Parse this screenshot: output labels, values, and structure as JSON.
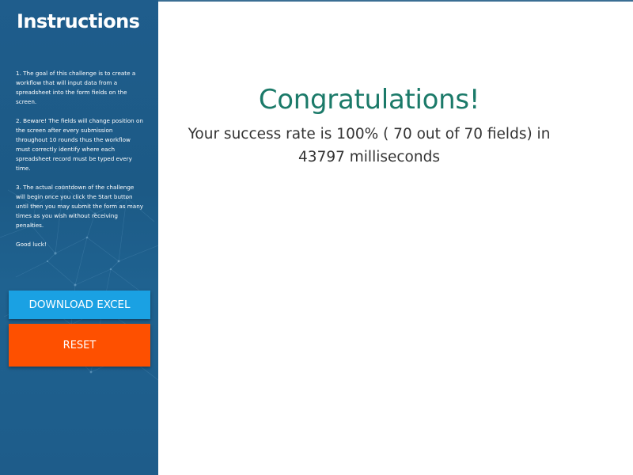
{
  "sidebar": {
    "title": "Instructions",
    "instructions": [
      "1. The goal of this challenge is to create a workflow that will input data from a spreadsheet into the form fields on the screen.",
      "2. Beware! The fields will change position on the screen after every submission throughout 10 rounds thus the workflow must correctly identify where each spreadsheet record must be typed every time.",
      "3. The actual countdown of the challenge will begin once you click the Start button until then you may submit the form as many times as you wish without receiving penalties.",
      "Good luck!"
    ],
    "download_button": "DOWNLOAD EXCEL",
    "reset_button": "RESET"
  },
  "main": {
    "heading": "Congratulations!",
    "result_line1": "Your success rate is 100% ( 70 out of 70 fields) in",
    "result_line2": "43797 milliseconds"
  },
  "colors": {
    "sidebar_bg": "#1e5c8a",
    "download_button": "#1aa1e3",
    "reset_button": "#fe5000",
    "heading": "#1b7a69"
  }
}
